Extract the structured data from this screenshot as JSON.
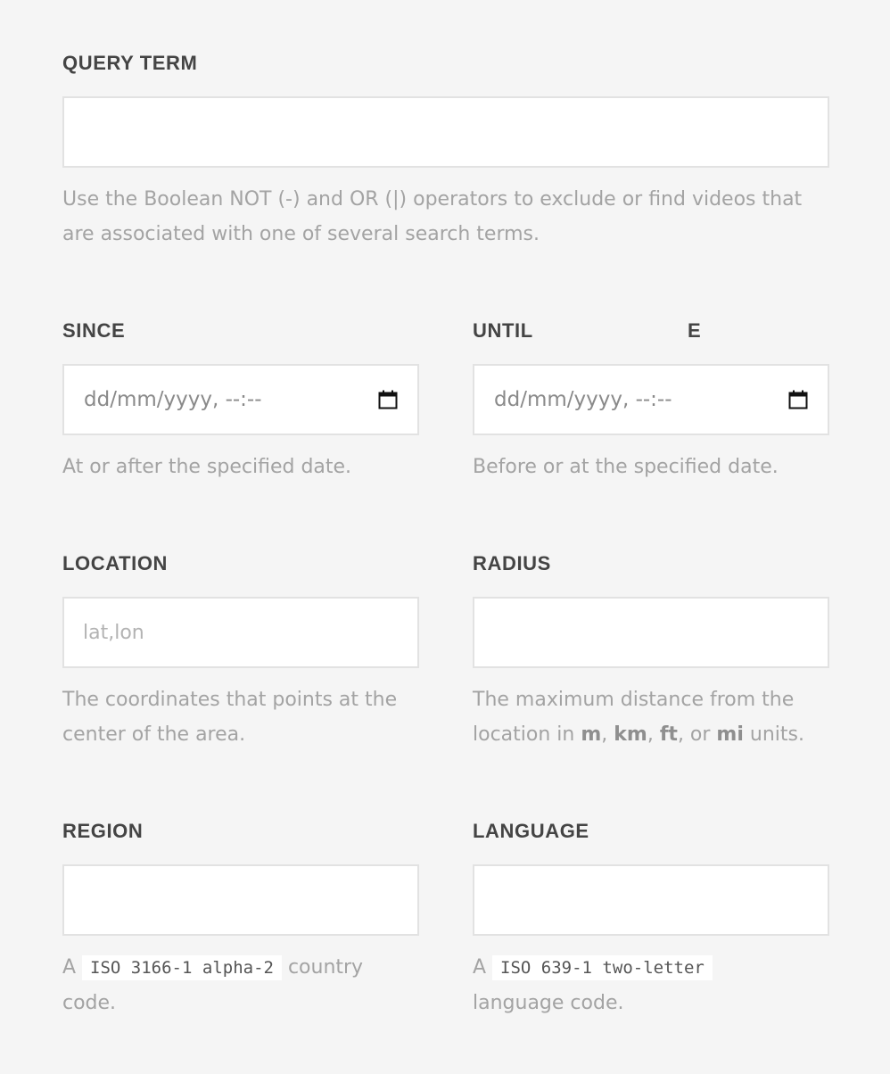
{
  "query_term": {
    "label": "QUERY TERM",
    "value": "",
    "help": "Use the Boolean NOT (-) and OR (|) operators to exclude or find videos that are associated with one of several search terms."
  },
  "since": {
    "label": "SINCE",
    "date_placeholder": "dd/mm/yyyy, --:--",
    "help": "At or after the specified date."
  },
  "until": {
    "label": "UNTIL",
    "stray_letter": "E",
    "date_placeholder": "dd/mm/yyyy, --:--",
    "help": "Before or at the specified date."
  },
  "location": {
    "label": "LOCATION",
    "placeholder": "lat,lon",
    "value": "",
    "help": "The coordinates that points at the center of the area."
  },
  "radius": {
    "label": "RADIUS",
    "value": "",
    "help_prefix": "The maximum distance from the location in ",
    "units": [
      "m",
      "km",
      "ft",
      "mi"
    ],
    "help_sep1": ", ",
    "help_sep2": ", ",
    "help_sep3": ", or ",
    "help_suffix": " units."
  },
  "region": {
    "label": "REGION",
    "value": "",
    "help_prefix": "A ",
    "code": "ISO 3166-1 alpha-2",
    "help_suffix": " country code."
  },
  "language": {
    "label": "LANGUAGE",
    "value": "",
    "help_prefix": "A ",
    "code": "ISO 639-1 two-letter",
    "help_suffix": " language code."
  },
  "icons": {
    "calendar": "calendar-icon"
  },
  "colors": {
    "background": "#f5f5f5",
    "label": "#444444",
    "help": "#a3a3a3",
    "field_border": "#e2e2e2",
    "placeholder": "#b3b3b3"
  }
}
